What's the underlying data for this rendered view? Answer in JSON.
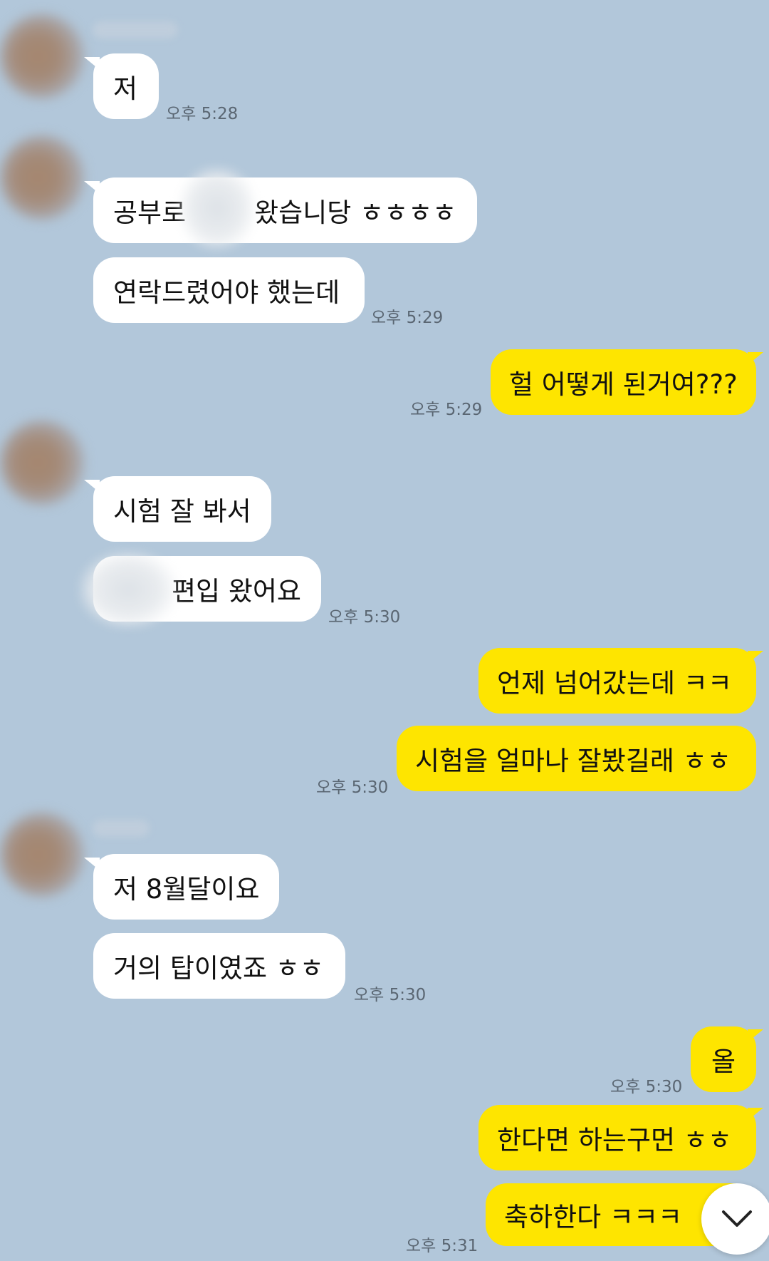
{
  "chat": {
    "messages": [
      {
        "text": "저"
      },
      {
        "text": "공부로",
        "text2": "왔습니당 ㅎㅎㅎㅎ"
      },
      {
        "text": "연락드렸어야 했는데"
      },
      {
        "text": "헐 어떻게 된거여???"
      },
      {
        "text": "시험 잘 봐서"
      },
      {
        "text": "편입 왔어요"
      },
      {
        "text": "언제 넘어갔는데 ㅋㅋ"
      },
      {
        "text": "시험을 얼마나 잘봤길래 ㅎㅎ"
      },
      {
        "text": "저 8월달이요"
      },
      {
        "text": "거의 탑이였죠 ㅎㅎ"
      },
      {
        "text": "올"
      },
      {
        "text": "한다면 하는구먼 ㅎㅎ"
      },
      {
        "text": "축하한다 ㅋㅋㅋ"
      }
    ],
    "timestamps": [
      "오후 5:28",
      "오후 5:29",
      "오후 5:29",
      "오후 5:30",
      "오후 5:30",
      "오후 5:30",
      "오후 5:30",
      "오후 5:31"
    ]
  },
  "colors": {
    "background": "#b2c7da",
    "incoming_bubble": "#ffffff",
    "outgoing_bubble": "#fee500",
    "timestamp": "#5a6672"
  },
  "icons": {
    "scroll_down": "chevron-down-icon"
  }
}
